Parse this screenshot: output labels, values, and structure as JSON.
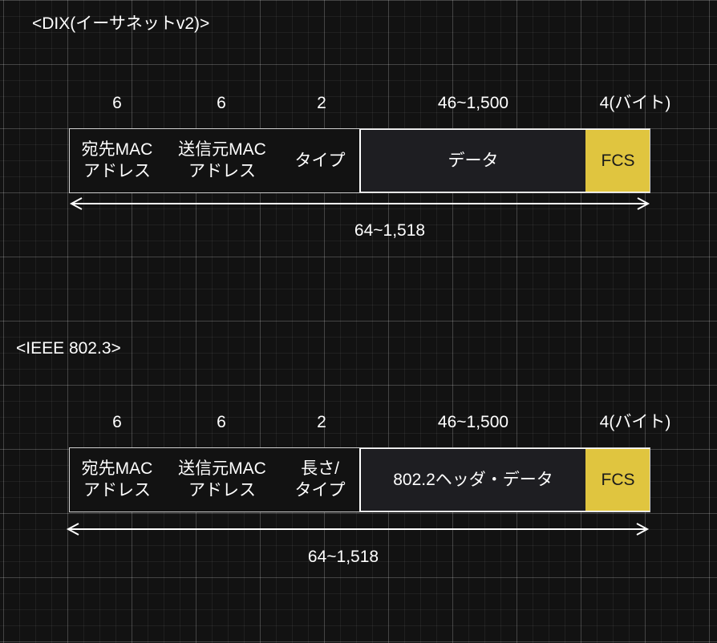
{
  "dix": {
    "title": "<DIX(イーサネットv2)>",
    "sizes": {
      "dest": "6",
      "src": "6",
      "type": "2",
      "data": "46~1,500",
      "fcs": "4(バイト)"
    },
    "fields": {
      "dest": "宛先MAC\nアドレス",
      "src": "送信元MAC\nアドレス",
      "type": "タイプ",
      "data": "データ",
      "fcs": "FCS"
    },
    "total": "64~1,518"
  },
  "ieee": {
    "title": "<IEEE 802.3>",
    "sizes": {
      "dest": "6",
      "src": "6",
      "type": "2",
      "data": "46~1,500",
      "fcs": "4(バイト)"
    },
    "fields": {
      "dest": "宛先MAC\nアドレス",
      "src": "送信元MAC\nアドレス",
      "type": "長さ/\nタイプ",
      "data": "802.2ヘッダ・データ",
      "fcs": "FCS"
    },
    "total": "64~1,518"
  },
  "colors": {
    "background": "#121212",
    "fcs_fill": "#e0c53f",
    "field_fill": "#1e1e22",
    "line": "#ffffff"
  }
}
